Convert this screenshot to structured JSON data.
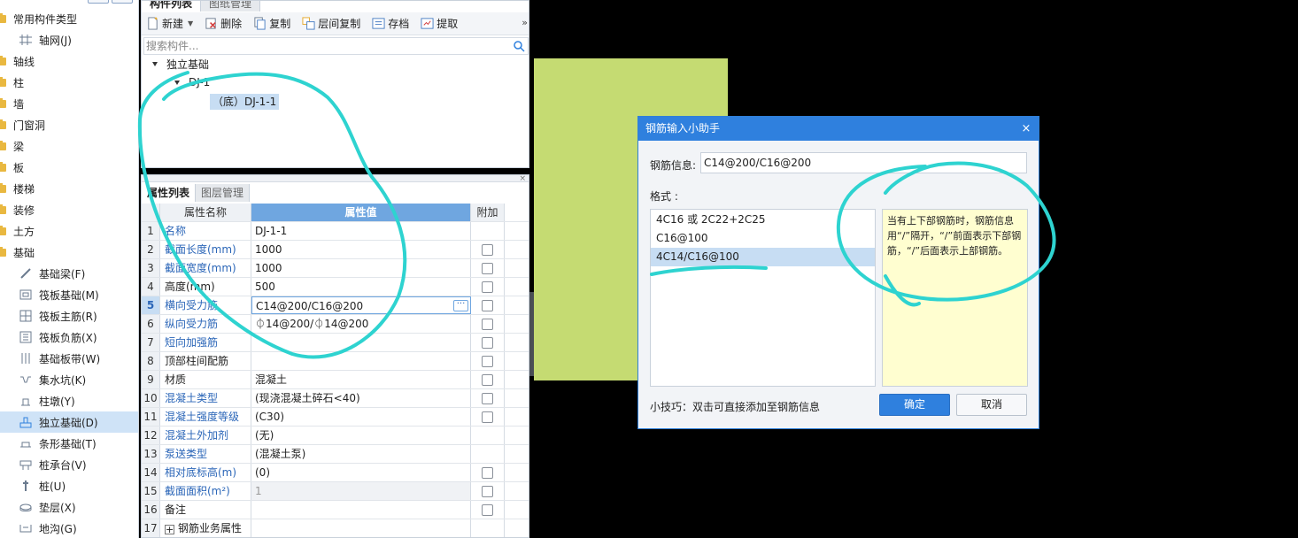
{
  "left_tree": {
    "items": [
      {
        "label": "常用构件类型",
        "kind": "folder"
      },
      {
        "label": "轴网(J)",
        "kind": "child",
        "icon": "grid-icon"
      },
      {
        "label": "轴线",
        "kind": "folder"
      },
      {
        "label": "柱",
        "kind": "folder"
      },
      {
        "label": "墙",
        "kind": "folder"
      },
      {
        "label": "门窗洞",
        "kind": "folder"
      },
      {
        "label": "梁",
        "kind": "folder"
      },
      {
        "label": "板",
        "kind": "folder"
      },
      {
        "label": "楼梯",
        "kind": "folder"
      },
      {
        "label": "装修",
        "kind": "folder"
      },
      {
        "label": "土方",
        "kind": "folder"
      },
      {
        "label": "基础",
        "kind": "folder"
      },
      {
        "label": "基础梁(F)",
        "kind": "child",
        "icon": "beam-icon"
      },
      {
        "label": "筏板基础(M)",
        "kind": "child",
        "icon": "raft-icon"
      },
      {
        "label": "筏板主筋(R)",
        "kind": "child",
        "icon": "rebar-grid-icon"
      },
      {
        "label": "筏板负筋(X)",
        "kind": "child",
        "icon": "neg-rebar-icon"
      },
      {
        "label": "基础板带(W)",
        "kind": "child",
        "icon": "strip-icon"
      },
      {
        "label": "集水坑(K)",
        "kind": "child",
        "icon": "pit-icon"
      },
      {
        "label": "柱墩(Y)",
        "kind": "child",
        "icon": "pier-icon"
      },
      {
        "label": "独立基础(D)",
        "kind": "child",
        "icon": "footing-icon",
        "selected": true
      },
      {
        "label": "条形基础(T)",
        "kind": "child",
        "icon": "strip-footing-icon"
      },
      {
        "label": "桩承台(V)",
        "kind": "child",
        "icon": "pile-cap-icon"
      },
      {
        "label": "桩(U)",
        "kind": "child",
        "icon": "pile-icon"
      },
      {
        "label": "垫层(X)",
        "kind": "child",
        "icon": "cushion-icon"
      },
      {
        "label": "地沟(G)",
        "kind": "child",
        "icon": "trench-icon"
      }
    ]
  },
  "component_panel": {
    "tabs": [
      "构件列表",
      "图纸管理"
    ],
    "toolbar": {
      "new_label": "新建",
      "delete_label": "删除",
      "copy_label": "复制",
      "floor_copy_label": "层间复制",
      "save_label": "存档",
      "extract_label": "提取",
      "more_label": "»"
    },
    "search": {
      "placeholder": "搜索构件..."
    },
    "tree": {
      "root": "独立基础",
      "child": "DJ-1",
      "leaf": "（底）DJ-1-1"
    }
  },
  "property_panel": {
    "tabs": [
      "属性列表",
      "图层管理"
    ],
    "close_label": "×",
    "columns": {
      "name": "属性名称",
      "value": "属性值",
      "extra": "附加"
    },
    "rows": [
      {
        "num": "1",
        "name": "名称",
        "value": "DJ-1-1",
        "check": false,
        "blue": true
      },
      {
        "num": "2",
        "name": "截面长度(mm)",
        "value": "1000",
        "check": true,
        "blue": true
      },
      {
        "num": "3",
        "name": "截面宽度(mm)",
        "value": "1000",
        "check": true,
        "blue": true
      },
      {
        "num": "4",
        "name": "高度(mm)",
        "value": "500",
        "check": true,
        "blue": false
      },
      {
        "num": "5",
        "name": "横向受力筋",
        "value": "C14@200/C16@200",
        "check": true,
        "blue": true,
        "active": true
      },
      {
        "num": "6",
        "name": "纵向受力筋",
        "value": "⏀14@200/⏀14@200",
        "check": true,
        "blue": true
      },
      {
        "num": "7",
        "name": "短向加强筋",
        "value": "",
        "check": true,
        "blue": true
      },
      {
        "num": "8",
        "name": "顶部柱间配筋",
        "value": "",
        "check": true,
        "blue": false
      },
      {
        "num": "9",
        "name": "材质",
        "value": "混凝土",
        "check": true,
        "blue": false
      },
      {
        "num": "10",
        "name": "混凝土类型",
        "value": "(现浇混凝土碎石<40)",
        "check": true,
        "blue": true
      },
      {
        "num": "11",
        "name": "混凝土强度等级",
        "value": "(C30)",
        "check": true,
        "blue": true
      },
      {
        "num": "12",
        "name": "混凝土外加剂",
        "value": "(无)",
        "check": false,
        "blue": true
      },
      {
        "num": "13",
        "name": "泵送类型",
        "value": "(混凝土泵)",
        "check": false,
        "blue": true
      },
      {
        "num": "14",
        "name": "相对底标高(m)",
        "value": "(0)",
        "check": true,
        "blue": true
      },
      {
        "num": "15",
        "name": "截面面积(m²)",
        "value": "1",
        "check": true,
        "blue": true,
        "gray": true
      },
      {
        "num": "16",
        "name": "备注",
        "value": "",
        "check": true,
        "blue": false
      },
      {
        "num": "17",
        "name": "钢筋业务属性",
        "value": "",
        "check": false,
        "blue": false,
        "expander": "+"
      }
    ]
  },
  "dialog": {
    "title": "钢筋输入小助手",
    "close_label": "×",
    "info_label": "钢筋信息:",
    "info_value": "C14@200/C16@200",
    "format_label": "格式 :",
    "formats": [
      "4C16 或 2C22+2C25",
      "C16@100",
      "4C14/C16@100"
    ],
    "selected_format": 2,
    "tip_text": "当有上下部钢筋时，钢筋信息用“/”隔开，“/”前面表示下部钢筋，“/”后面表示上部钢筋。",
    "hint_text": "小技巧：双击可直接添加至钢筋信息",
    "ok_label": "确定",
    "cancel_label": "取消"
  },
  "colors": {
    "accent": "#2f80de",
    "annotation": "#2ed3d0",
    "green_block": "#c5db72",
    "tip_bg": "#fffed0"
  }
}
